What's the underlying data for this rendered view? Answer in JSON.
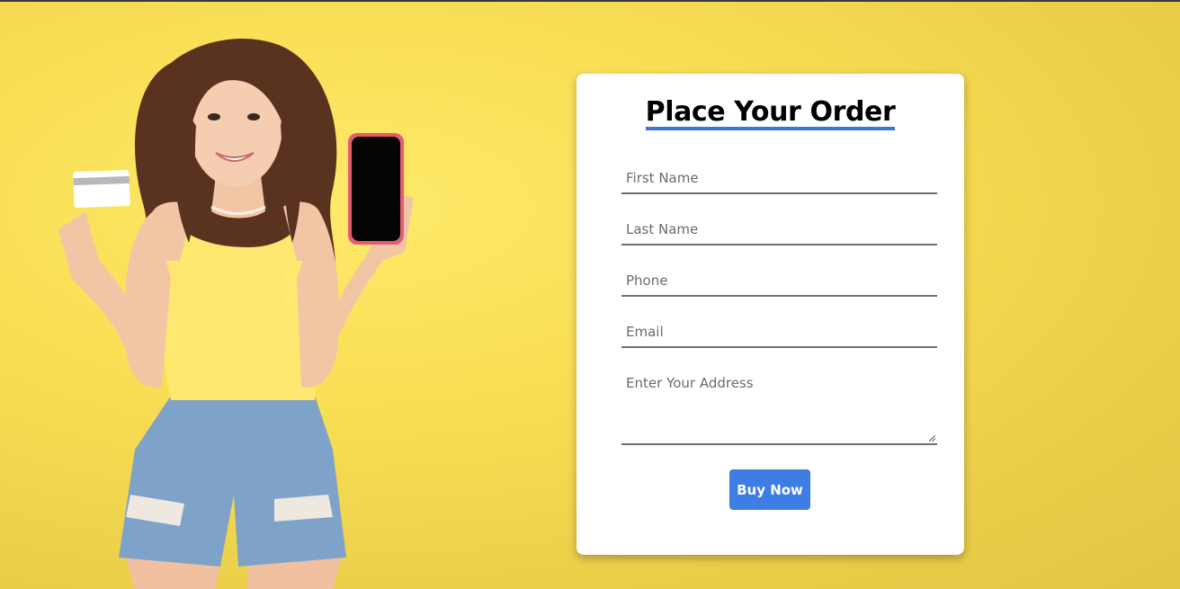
{
  "page": {
    "background_color": "#f9df55"
  },
  "hero_image": {
    "description_icon": "woman-holding-card-and-phone"
  },
  "order_form": {
    "title": "Place Your Order",
    "title_underline_color": "#3b76d8",
    "fields": {
      "first_name": {
        "placeholder": "First Name",
        "value": ""
      },
      "last_name": {
        "placeholder": "Last Name",
        "value": ""
      },
      "phone": {
        "placeholder": "Phone",
        "value": ""
      },
      "email": {
        "placeholder": "Email",
        "value": ""
      },
      "address": {
        "placeholder": "Enter Your Address",
        "value": ""
      }
    },
    "submit_label": "Buy Now",
    "submit_color": "#3e7de3"
  }
}
